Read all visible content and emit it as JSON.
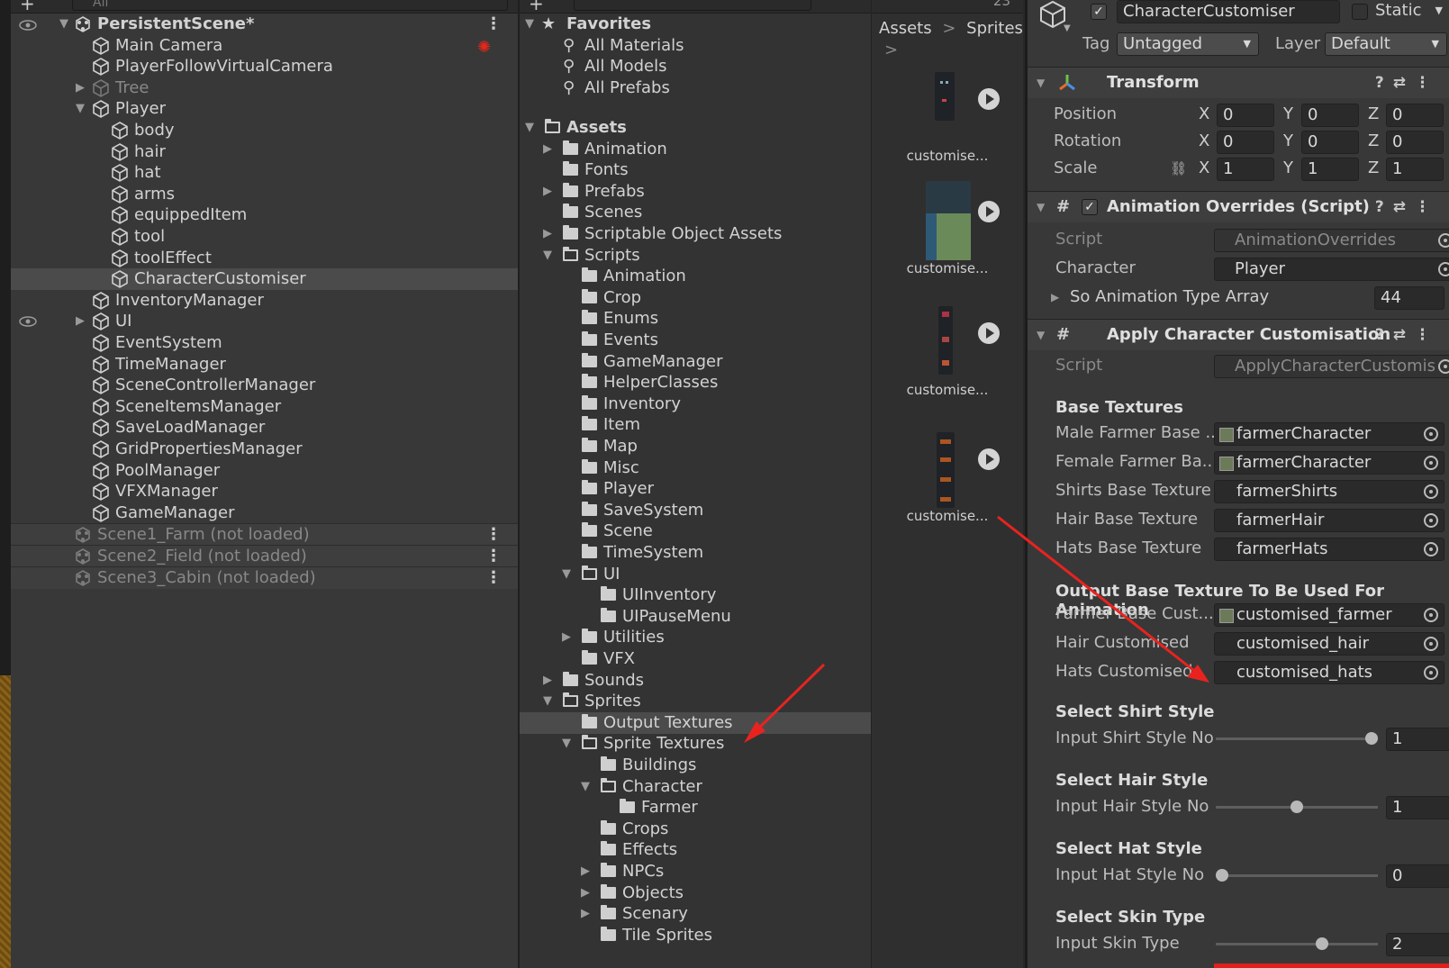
{
  "hierarchy": {
    "search_placeholder": "All",
    "root_scene": "PersistentScene*",
    "items": [
      {
        "label": "Main Camera"
      },
      {
        "label": "PlayerFollowVirtualCamera"
      },
      {
        "label": "Tree"
      },
      {
        "label": "Player"
      },
      {
        "label": "body"
      },
      {
        "label": "hair"
      },
      {
        "label": "hat"
      },
      {
        "label": "arms"
      },
      {
        "label": "equippedItem"
      },
      {
        "label": "tool"
      },
      {
        "label": "toolEffect"
      },
      {
        "label": "CharacterCustomiser"
      },
      {
        "label": "InventoryManager"
      },
      {
        "label": "UI"
      },
      {
        "label": "EventSystem"
      },
      {
        "label": "TimeManager"
      },
      {
        "label": "SceneControllerManager"
      },
      {
        "label": "SceneItemsManager"
      },
      {
        "label": "SaveLoadManager"
      },
      {
        "label": "GridPropertiesManager"
      },
      {
        "label": "PoolManager"
      },
      {
        "label": "VFXManager"
      },
      {
        "label": "GameManager"
      }
    ],
    "unloaded_scenes": [
      "Scene1_Farm (not loaded)",
      "Scene2_Field (not loaded)",
      "Scene3_Cabin (not loaded)"
    ]
  },
  "project": {
    "favorites_label": "Favorites",
    "favorites": [
      "All Materials",
      "All Models",
      "All Prefabs"
    ],
    "assets_label": "Assets",
    "tree": [
      "Animation",
      "Fonts",
      "Prefabs",
      "Scenes",
      "Scriptable Object Assets",
      "Scripts",
      "Animation",
      "Crop",
      "Enums",
      "Events",
      "GameManager",
      "HelperClasses",
      "Inventory",
      "Item",
      "Map",
      "Misc",
      "Player",
      "SaveSystem",
      "Scene",
      "TimeSystem",
      "UI",
      "UIInventory",
      "UIPauseMenu",
      "Utilities",
      "VFX",
      "Sounds",
      "Sprites",
      "Output Textures",
      "Sprite Textures",
      "Buildings",
      "Character",
      "Farmer",
      "Crops",
      "Effects",
      "NPCs",
      "Objects",
      "Scenary",
      "Tile Sprites"
    ],
    "breadcrumb": [
      "Assets",
      "Sprites"
    ],
    "hidden_count": "23",
    "assets": [
      "customise...",
      "customise...",
      "customise...",
      "customise..."
    ]
  },
  "inspector": {
    "object_name": "CharacterCustomiser",
    "static_label": "Static",
    "tag_label": "Tag",
    "tag_value": "Untagged",
    "layer_label": "Layer",
    "layer_value": "Default",
    "transform": {
      "title": "Transform",
      "rows": [
        {
          "label": "Position",
          "x": "0",
          "y": "0",
          "z": "0"
        },
        {
          "label": "Rotation",
          "x": "0",
          "y": "0",
          "z": "0"
        },
        {
          "label": "Scale",
          "x": "1",
          "y": "1",
          "z": "1"
        }
      ]
    },
    "anim_overrides": {
      "title": "Animation Overrides (Script)",
      "script_label": "Script",
      "script_value": "AnimationOverrides",
      "character_label": "Character",
      "character_value": "Player",
      "array_label": "So Animation Type Array",
      "array_value": "44"
    },
    "apply_custom": {
      "title": "Apply Character Customisation",
      "script_label": "Script",
      "script_value": "ApplyCharacterCustomis",
      "base_textures": "Base Textures",
      "male_label": "Male Farmer Base ...",
      "male_value": "farmerCharacter",
      "female_label": "Female Farmer Ba...",
      "female_value": "farmerCharacter",
      "shirts_label": "Shirts Base Texture",
      "shirts_value": "farmerShirts",
      "hair_label": "Hair Base Texture",
      "hair_value": "farmerHair",
      "hats_label": "Hats Base Texture",
      "hats_value": "farmerHats",
      "output_section": "Output Base Texture To Be Used For Animation",
      "farmer_cust_label": "Farmer Base Cust...",
      "farmer_cust_value": "customised_farmer",
      "hair_cust_label": "Hair Customised",
      "hair_cust_value": "customised_hair",
      "hats_cust_label": "Hats Customised",
      "hats_cust_value": "customised_hats",
      "shirt_section": "Select Shirt Style",
      "shirt_label": "Input Shirt Style No",
      "shirt_value": "1",
      "shirt_level": 1.0,
      "hair_section": "Select Hair Style",
      "hair_style_label": "Input Hair Style No",
      "hair_style_value": "1",
      "hair_level": 0.5,
      "hat_section": "Select Hat Style",
      "hat_label": "Input Hat Style No",
      "hat_value": "0",
      "hat_level": 0.0,
      "skin_section": "Select Skin Type",
      "skin_label": "Input Skin Type",
      "skin_value": "2",
      "skin_level": 0.667
    }
  },
  "colors": {
    "annotation_arrow": "#e8231f",
    "accent_bar": "#e01f1f"
  }
}
